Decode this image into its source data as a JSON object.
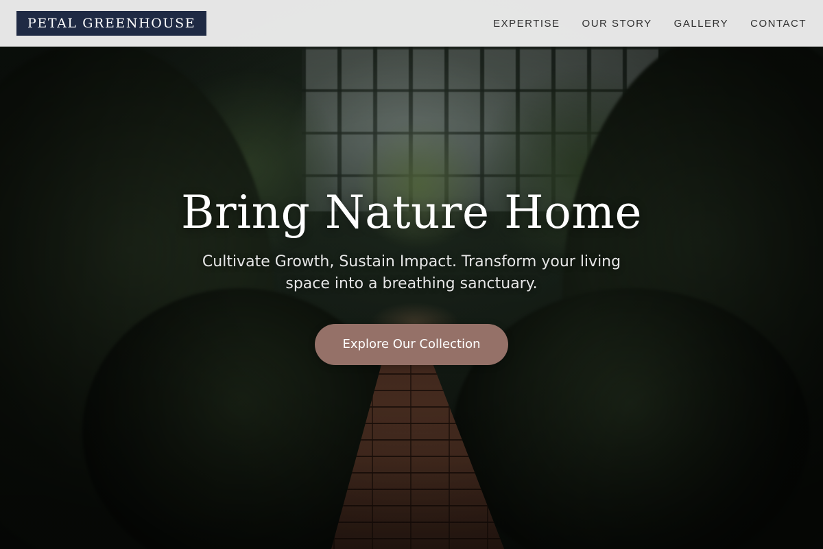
{
  "brand": {
    "logo_text": "PETAL GREENHOUSE"
  },
  "nav": {
    "items": [
      {
        "label": "EXPERTISE"
      },
      {
        "label": "OUR STORY"
      },
      {
        "label": "GALLERY"
      },
      {
        "label": "CONTACT"
      }
    ]
  },
  "hero": {
    "title": "Bring Nature Home",
    "subtitle": "Cultivate Growth, Sustain Impact. Transform your living space into a breathing sanctuary.",
    "cta_label": "Explore Our Collection",
    "background_image": "greenhouse-interior-with-brick-path"
  },
  "colors": {
    "navbar_bg": "#eeeeee",
    "logo_bg": "#1f2a44",
    "cta_bg": "#957168",
    "hero_text": "#ffffff"
  }
}
